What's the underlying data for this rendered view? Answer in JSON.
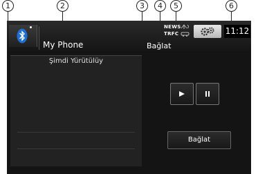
{
  "callouts": [
    "1",
    "2",
    "3",
    "4",
    "5",
    "6"
  ],
  "header": {
    "device_name": "My Phone",
    "connection_status": "Bağlat",
    "news_label": "NEWS",
    "traffic_label": "TRFC",
    "clock": "11:12"
  },
  "now_playing": {
    "title": "Şimdi Yürütülüy"
  },
  "controls": {
    "connect_label": "Bağlat"
  },
  "icons": {
    "bluetooth": "bluetooth-icon",
    "settings": "gears-icon",
    "play": "play-icon",
    "pause": "pause-icon"
  },
  "colors": {
    "screen_bg": "#141414",
    "bluetooth_blue": "#1f6fd1"
  }
}
